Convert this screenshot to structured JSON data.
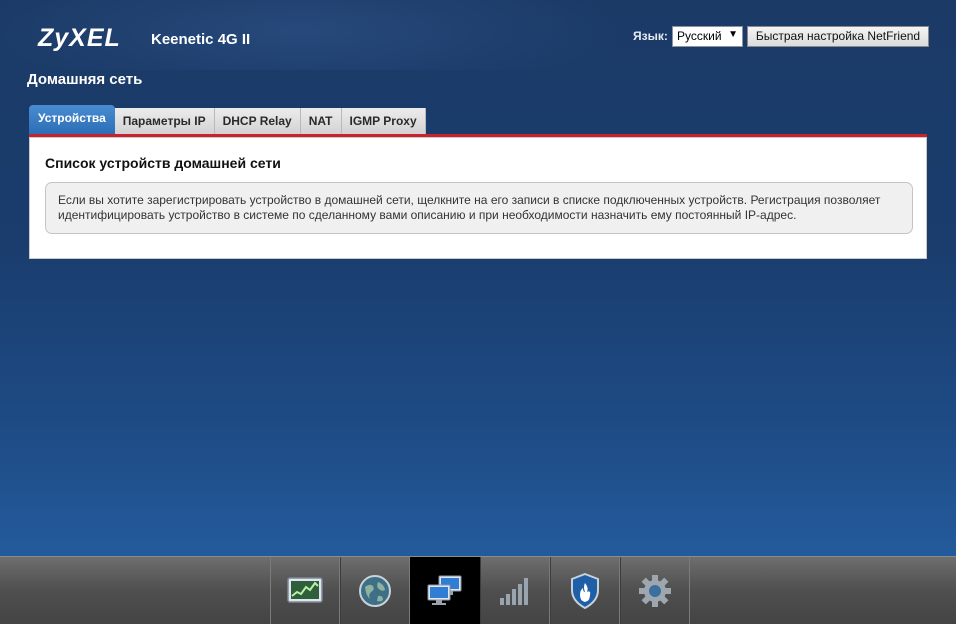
{
  "header": {
    "logo_text": "ZyXEL",
    "model": "Keenetic 4G II",
    "language_label": "Язык:",
    "language_value": "Русский",
    "quick_setup_button": "Быстрая настройка NetFriend"
  },
  "page": {
    "title": "Домашняя сеть"
  },
  "tabs": [
    {
      "label": "Устройства",
      "active": true
    },
    {
      "label": "Параметры IP",
      "active": false
    },
    {
      "label": "DHCP Relay",
      "active": false
    },
    {
      "label": "NAT",
      "active": false
    },
    {
      "label": "IGMP Proxy",
      "active": false
    }
  ],
  "panel": {
    "title": "Список устройств домашней сети",
    "info_text": "Если вы хотите зарегистрировать устройство в домашней сети, щелкните на его записи в списке подключенных устройств. Регистрация позволяет идентифицировать устройство в системе по сделанному вами описанию и при необходимости назначить ему постоянный IP-адрес."
  },
  "bottom_nav": [
    {
      "icon": "monitor-chart-icon",
      "active": false
    },
    {
      "icon": "globe-icon",
      "active": false
    },
    {
      "icon": "home-network-icon",
      "active": true
    },
    {
      "icon": "signal-bars-icon",
      "active": false
    },
    {
      "icon": "security-shield-icon",
      "active": false
    },
    {
      "icon": "settings-gear-icon",
      "active": false
    }
  ],
  "colors": {
    "tab_active": "#2b6fb7",
    "accent_line": "#c8232c",
    "background": "#1b3a66"
  }
}
